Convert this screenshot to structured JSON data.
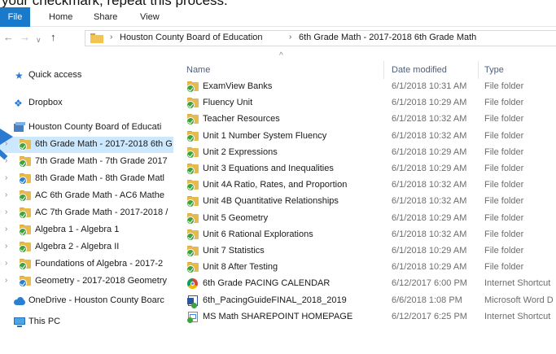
{
  "caption": "your checkmark, repeat this process.",
  "ribbon": {
    "tabs": [
      "File",
      "Home",
      "Share",
      "View"
    ]
  },
  "address": {
    "crumbs": [
      "Houston County Board of Education",
      "6th Grade Math - 2017-2018 6th Grade Math"
    ]
  },
  "sidebar": {
    "quick_access": "Quick access",
    "dropbox": "Dropbox",
    "houston": "Houston County Board of Educati",
    "items": [
      "6th Grade Math - 2017-2018 6th G",
      "7th Grade Math - 7th Grade 2017",
      "8th Grade Math - 8th Grade Matl",
      "AC 6th Grade Math - AC6 Mathe",
      "AC 7th Grade Math - 2017-2018 /",
      "Algebra 1 - Algebra 1",
      "Algebra 2 - Algebra II",
      "Foundations of Algebra - 2017-2",
      "Geometry - 2017-2018 Geometry"
    ],
    "onedrive": "OneDrive - Houston County Boarc",
    "thispc": "This PC"
  },
  "columns": {
    "name": "Name",
    "date": "Date modified",
    "type": "Type"
  },
  "files": [
    {
      "name": "ExamView Banks",
      "date": "6/1/2018 10:31 AM",
      "type": "File folder",
      "icon": "folder-icon"
    },
    {
      "name": "Fluency Unit",
      "date": "6/1/2018 10:29 AM",
      "type": "File folder",
      "icon": "folder-icon"
    },
    {
      "name": "Teacher Resources",
      "date": "6/1/2018 10:32 AM",
      "type": "File folder",
      "icon": "folder-icon"
    },
    {
      "name": "Unit 1 Number System Fluency",
      "date": "6/1/2018 10:32 AM",
      "type": "File folder",
      "icon": "folder-icon"
    },
    {
      "name": "Unit 2 Expressions",
      "date": "6/1/2018 10:29 AM",
      "type": "File folder",
      "icon": "folder-icon"
    },
    {
      "name": "Unit 3 Equations and Inequalities",
      "date": "6/1/2018 10:29 AM",
      "type": "File folder",
      "icon": "folder-icon"
    },
    {
      "name": "Unit 4A Ratio, Rates, and Proportion",
      "date": "6/1/2018 10:32 AM",
      "type": "File folder",
      "icon": "folder-icon"
    },
    {
      "name": "Unit 4B Quantitative Relationships",
      "date": "6/1/2018 10:32 AM",
      "type": "File folder",
      "icon": "folder-icon"
    },
    {
      "name": "Unit 5 Geometry",
      "date": "6/1/2018 10:29 AM",
      "type": "File folder",
      "icon": "folder-icon"
    },
    {
      "name": "Unit 6 Rational Explorations",
      "date": "6/1/2018 10:32 AM",
      "type": "File folder",
      "icon": "folder-icon"
    },
    {
      "name": "Unit 7 Statistics",
      "date": "6/1/2018 10:29 AM",
      "type": "File folder",
      "icon": "folder-icon"
    },
    {
      "name": "Unit 8 After Testing",
      "date": "6/1/2018 10:29 AM",
      "type": "File folder",
      "icon": "folder-icon"
    },
    {
      "name": "6th Grade PACING CALENDAR",
      "date": "6/12/2017 6:00 PM",
      "type": "Internet Shortcut",
      "icon": "chrome-shortcut-icon"
    },
    {
      "name": "6th_PacingGuideFINAL_2018_2019",
      "date": "6/6/2018 1:08 PM",
      "type": "Microsoft Word D",
      "icon": "word-doc-icon"
    },
    {
      "name": "MS Math SHAREPOINT HOMEPAGE",
      "date": "6/12/2017 6:25 PM",
      "type": "Internet Shortcut",
      "icon": "link-shortcut-icon"
    }
  ],
  "colors": {
    "file_tab": "#1979ca",
    "selected": "#cce8ff",
    "folder": "#e8b94c",
    "sync_check": "#3da33d",
    "arrow": "#2b79d0"
  }
}
